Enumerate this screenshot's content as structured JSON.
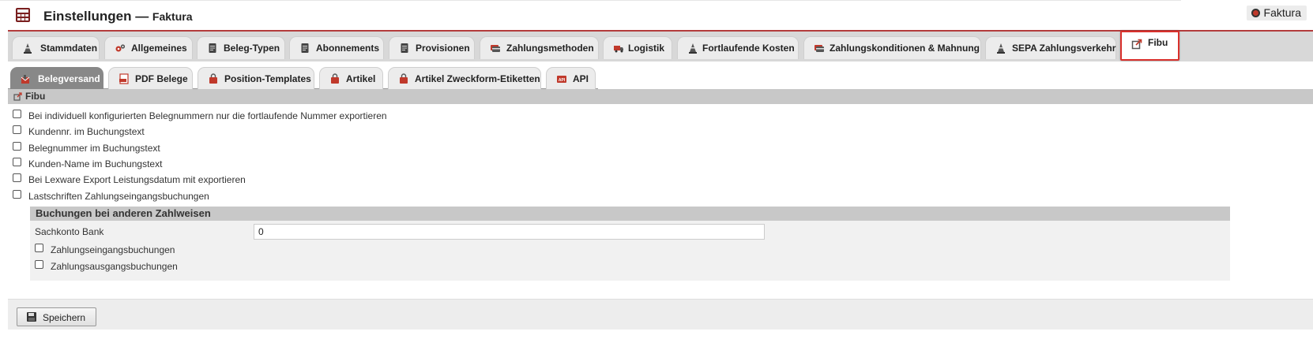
{
  "header": {
    "title": "Einstellungen",
    "separator": " — ",
    "subtitle": "Faktura",
    "module_badge": "Faktura"
  },
  "main_tabs": [
    {
      "label": "Stammdaten",
      "icon": "cone-icon"
    },
    {
      "label": "Allgemeines",
      "icon": "gears-icon"
    },
    {
      "label": "Beleg-Typen",
      "icon": "document-icon"
    },
    {
      "label": "Abonnements",
      "icon": "document-icon"
    },
    {
      "label": "Provisionen",
      "icon": "document-icon"
    },
    {
      "label": "Zahlungsmethoden",
      "icon": "card-icon"
    },
    {
      "label": "Logistik",
      "icon": "truck-icon"
    },
    {
      "label": "Fortlaufende Kosten",
      "icon": "cone-icon"
    },
    {
      "label": "Zahlungskonditionen & Mahnung",
      "icon": "card-icon"
    },
    {
      "label": "SEPA Zahlungsverkehr",
      "icon": "cone-icon"
    },
    {
      "label": "Fibu",
      "icon": "export-icon"
    }
  ],
  "sub_tabs": [
    {
      "label": "Belegversand",
      "icon": "mail-icon"
    },
    {
      "label": "PDF Belege",
      "icon": "pdf-icon"
    },
    {
      "label": "Position-Templates",
      "icon": "bag-icon"
    },
    {
      "label": "Artikel",
      "icon": "bag-icon"
    },
    {
      "label": "Artikel Zweckform-Etiketten",
      "icon": "bag-icon"
    },
    {
      "label": "API",
      "icon": "api-icon"
    }
  ],
  "section": {
    "title": "Fibu",
    "options": [
      "Bei individuell konfigurierten Belegnummern nur die fortlaufende Nummer exportieren",
      "Kundennr. im Buchungstext",
      "Belegnummer im Buchungstext",
      "Kunden-Name im Buchungstext",
      "Bei Lexware Export Leistungsdatum mit exportieren",
      "Lastschriften Zahlungseingangsbuchungen"
    ]
  },
  "subpanel": {
    "title": "Buchungen bei anderen Zahlweisen",
    "sachkonto_label": "Sachkonto Bank",
    "sachkonto_value": "0",
    "option_1": "Zahlungseingangsbuchungen",
    "option_2": "Zahlungsausgangsbuchungen"
  },
  "footer": {
    "save_label": "Speichern"
  },
  "colors": {
    "accent_red": "#b33c3c",
    "highlight_red": "#d9302c",
    "active_subtab": "#888888"
  }
}
